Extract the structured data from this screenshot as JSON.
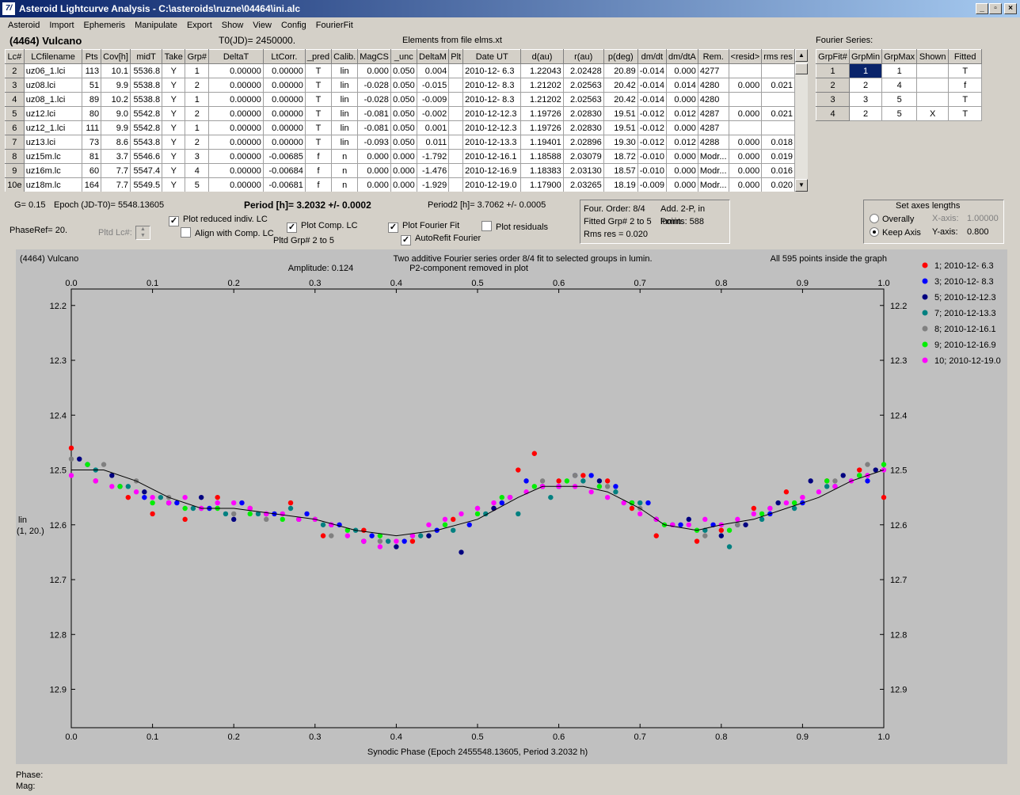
{
  "window": {
    "title": "Asteroid Lightcurve Analysis - C:\\asteroids\\ruzne\\04464\\ini.alc",
    "icon": "app-icon"
  },
  "menu": [
    "Asteroid",
    "Import",
    "Ephemeris",
    "Manipulate",
    "Export",
    "Show",
    "View",
    "Config",
    "FourierFit"
  ],
  "header": {
    "object": "(4464) Vulcano",
    "t0": "T0(JD)= 2450000.",
    "elements": "Elements from file elms.xt",
    "fourier_title": "Fourier Series:"
  },
  "lc_table": {
    "columns": [
      "Lc#",
      "LCfilename",
      "Pts",
      "Cov[h]",
      "midT",
      "Take",
      "Grp#",
      "DeltaT",
      "LtCorr.",
      "_pred",
      "Calib.",
      "MagCS",
      "_unc",
      "DeltaM",
      "Plt",
      "Date UT",
      "d(au)",
      "r(au)",
      "p(deg)",
      "dm/dt",
      "dm/dtA",
      "Rem.",
      "<resid>",
      "rms res"
    ],
    "rows": [
      [
        "2",
        "uz06_1.lci",
        "113",
        "10.1",
        "5536.8",
        "Y",
        "1",
        "0.00000",
        "0.00000",
        "T",
        "lin",
        "0.000",
        "0.050",
        "0.004",
        "",
        "2010-12- 6.3",
        "1.22043",
        "2.02428",
        "20.89",
        "-0.014",
        "0.000",
        "4277",
        "",
        ""
      ],
      [
        "3",
        "uz08.lci",
        "51",
        "9.9",
        "5538.8",
        "Y",
        "2",
        "0.00000",
        "0.00000",
        "T",
        "lin",
        "-0.028",
        "0.050",
        "-0.015",
        "",
        "2010-12- 8.3",
        "1.21202",
        "2.02563",
        "20.42",
        "-0.014",
        "0.014",
        "4280",
        "0.000",
        "0.021"
      ],
      [
        "4",
        "uz08_1.lci",
        "89",
        "10.2",
        "5538.8",
        "Y",
        "1",
        "0.00000",
        "0.00000",
        "T",
        "lin",
        "-0.028",
        "0.050",
        "-0.009",
        "",
        "2010-12- 8.3",
        "1.21202",
        "2.02563",
        "20.42",
        "-0.014",
        "0.000",
        "4280",
        "",
        ""
      ],
      [
        "5",
        "uz12.lci",
        "80",
        "9.0",
        "5542.8",
        "Y",
        "2",
        "0.00000",
        "0.00000",
        "T",
        "lin",
        "-0.081",
        "0.050",
        "-0.002",
        "",
        "2010-12-12.3",
        "1.19726",
        "2.02830",
        "19.51",
        "-0.012",
        "0.012",
        "4287",
        "0.000",
        "0.021"
      ],
      [
        "6",
        "uz12_1.lci",
        "111",
        "9.9",
        "5542.8",
        "Y",
        "1",
        "0.00000",
        "0.00000",
        "T",
        "lin",
        "-0.081",
        "0.050",
        "0.001",
        "",
        "2010-12-12.3",
        "1.19726",
        "2.02830",
        "19.51",
        "-0.012",
        "0.000",
        "4287",
        "",
        ""
      ],
      [
        "7",
        "uz13.lci",
        "73",
        "8.6",
        "5543.8",
        "Y",
        "2",
        "0.00000",
        "0.00000",
        "T",
        "lin",
        "-0.093",
        "0.050",
        "0.011",
        "",
        "2010-12-13.3",
        "1.19401",
        "2.02896",
        "19.30",
        "-0.012",
        "0.012",
        "4288",
        "0.000",
        "0.018"
      ],
      [
        "8",
        "uz15m.lc",
        "81",
        "3.7",
        "5546.6",
        "Y",
        "3",
        "0.00000",
        "-0.00685",
        "f",
        "n",
        "0.000",
        "0.000",
        "-1.792",
        "",
        "2010-12-16.1",
        "1.18588",
        "2.03079",
        "18.72",
        "-0.010",
        "0.000",
        "Modr...",
        "0.000",
        "0.019"
      ],
      [
        "9",
        "uz16m.lc",
        "60",
        "7.7",
        "5547.4",
        "Y",
        "4",
        "0.00000",
        "-0.00684",
        "f",
        "n",
        "0.000",
        "0.000",
        "-1.476",
        "",
        "2010-12-16.9",
        "1.18383",
        "2.03130",
        "18.57",
        "-0.010",
        "0.000",
        "Modr...",
        "0.000",
        "0.016"
      ],
      [
        "10e",
        "uz18m.lc",
        "164",
        "7.7",
        "5549.5",
        "Y",
        "5",
        "0.00000",
        "-0.00681",
        "f",
        "n",
        "0.000",
        "0.000",
        "-1.929",
        "",
        "2010-12-19.0",
        "1.17900",
        "2.03265",
        "18.19",
        "-0.009",
        "0.000",
        "Modr...",
        "0.000",
        "0.020"
      ]
    ]
  },
  "fourier_table": {
    "columns": [
      "GrpFit#",
      "GrpMin",
      "GrpMax",
      "Shown",
      "Fitted"
    ],
    "rows": [
      [
        "1",
        "1",
        "1",
        "",
        "T"
      ],
      [
        "2",
        "2",
        "4",
        "",
        "f"
      ],
      [
        "3",
        "3",
        "5",
        "",
        "T"
      ],
      [
        "4",
        "2",
        "5",
        "X",
        "T"
      ]
    ]
  },
  "controls": {
    "g": "G= 0.15",
    "epoch": "Epoch (JD-T0)= 5548.13605",
    "period": "Period [h]= 3.2032 +/- 0.0002",
    "period2": "Period2 [h]= 3.7062 +/- 0.0005",
    "phaseref": "PhaseRef= 20.",
    "pltd_lc": "Pltd Lc#:",
    "pltd_grp": "Pltd Grp#  2  to  5",
    "plot_reduced": "Plot reduced indiv. LC",
    "align_comp": "Align with Comp. LC",
    "plot_comp": "Plot Comp. LC",
    "plot_fourier": "Plot Fourier Fit",
    "autorefit": "AutoRefit Fourier",
    "plot_resid": "Plot residuals",
    "info1a": "Four. Order:  8/4",
    "info1b": "Add. 2-P, in lumin.",
    "info2a": "Fitted Grp# 2 to 5",
    "info2b": "Points: 588",
    "info3": "Rms res    = 0.020",
    "axes_title": "Set axes lengths",
    "overally": "Overally",
    "keep_axis": "Keep Axis",
    "xaxis_label": "X-axis:",
    "xaxis_val": "1.00000",
    "yaxis_label": "Y-axis:",
    "yaxis_val": "0.800"
  },
  "status": {
    "phase": "Phase:",
    "mag": "Mag:"
  },
  "chart_data": {
    "type": "scatter",
    "title": "Two additive Fourier series order 8/4 fit to selected groups in lumin.",
    "subtitle_left": "Amplitude: 0.124",
    "subtitle_right": "P2-component removed in plot",
    "corner_left": "(4464) Vulcano",
    "corner_right": "All 595 points inside the graph",
    "xlabel": "Synodic Phase (Epoch 2455548.13605, Period 3.2032 h)",
    "ylabel_1": "lin",
    "ylabel_2": "(1, 20.)",
    "xlim": [
      0,
      1
    ],
    "ylim": [
      12.17,
      12.97
    ],
    "y_inverted": true,
    "xticks": [
      "0.0",
      "0.1",
      "0.2",
      "0.3",
      "0.4",
      "0.5",
      "0.6",
      "0.7",
      "0.8",
      "0.9",
      "1.0"
    ],
    "yticks": [
      "12.2",
      "12.3",
      "12.4",
      "12.5",
      "12.6",
      "12.7",
      "12.8",
      "12.9"
    ],
    "ytick_values": [
      12.2,
      12.3,
      12.4,
      12.5,
      12.6,
      12.7,
      12.8,
      12.9
    ],
    "fit_curve": {
      "x": [
        0,
        0.04,
        0.08,
        0.12,
        0.16,
        0.2,
        0.25,
        0.3,
        0.35,
        0.4,
        0.45,
        0.5,
        0.55,
        0.58,
        0.6,
        0.63,
        0.66,
        0.7,
        0.73,
        0.77,
        0.8,
        0.84,
        0.88,
        0.92,
        0.96,
        1.0
      ],
      "y": [
        12.5,
        12.5,
        12.52,
        12.55,
        12.57,
        12.57,
        12.58,
        12.59,
        12.61,
        12.62,
        12.61,
        12.59,
        12.55,
        12.53,
        12.53,
        12.53,
        12.54,
        12.57,
        12.6,
        12.61,
        12.6,
        12.59,
        12.57,
        12.55,
        12.52,
        12.5
      ]
    },
    "series": [
      {
        "name": "1; 2010-12- 6.3",
        "color": "#ff0000",
        "marker": "circle",
        "x": [
          0.0,
          0.03,
          0.07,
          0.1,
          0.14,
          0.18,
          0.22,
          0.27,
          0.31,
          0.36,
          0.42,
          0.47,
          0.52,
          0.55,
          0.57,
          0.6,
          0.63,
          0.66,
          0.69,
          0.72,
          0.77,
          0.8,
          0.84,
          0.88,
          0.93,
          0.97,
          1.0
        ],
        "y": [
          12.46,
          12.52,
          12.55,
          12.58,
          12.59,
          12.55,
          12.57,
          12.56,
          12.62,
          12.61,
          12.63,
          12.59,
          12.57,
          12.5,
          12.47,
          12.52,
          12.51,
          12.52,
          12.57,
          12.62,
          12.63,
          12.61,
          12.57,
          12.54,
          12.52,
          12.5,
          12.55
        ]
      },
      {
        "name": "3; 2010-12- 8.3",
        "color": "#0000ff",
        "marker": "circle",
        "x": [
          0.02,
          0.06,
          0.09,
          0.13,
          0.17,
          0.21,
          0.25,
          0.29,
          0.33,
          0.37,
          0.41,
          0.45,
          0.49,
          0.53,
          0.56,
          0.6,
          0.64,
          0.67,
          0.71,
          0.75,
          0.79,
          0.82,
          0.86,
          0.9,
          0.94,
          0.98
        ],
        "y": [
          12.49,
          12.53,
          12.55,
          12.56,
          12.57,
          12.56,
          12.58,
          12.58,
          12.6,
          12.62,
          12.63,
          12.61,
          12.6,
          12.56,
          12.52,
          12.53,
          12.51,
          12.53,
          12.56,
          12.6,
          12.6,
          12.6,
          12.58,
          12.56,
          12.53,
          12.52
        ]
      },
      {
        "name": "5; 2010-12-12.3",
        "color": "#000080",
        "marker": "circle",
        "x": [
          0.01,
          0.05,
          0.09,
          0.12,
          0.16,
          0.2,
          0.24,
          0.28,
          0.32,
          0.36,
          0.4,
          0.44,
          0.48,
          0.52,
          0.54,
          0.58,
          0.62,
          0.65,
          0.69,
          0.72,
          0.76,
          0.8,
          0.83,
          0.87,
          0.91,
          0.95,
          0.99
        ],
        "y": [
          12.48,
          12.51,
          12.54,
          12.56,
          12.55,
          12.59,
          12.58,
          12.59,
          12.6,
          12.63,
          12.64,
          12.62,
          12.65,
          12.57,
          12.55,
          12.53,
          12.51,
          12.52,
          12.56,
          12.59,
          12.59,
          12.62,
          12.6,
          12.56,
          12.52,
          12.51,
          12.5
        ]
      },
      {
        "name": "7; 2010-12-13.3",
        "color": "#008080",
        "marker": "circle",
        "x": [
          0.03,
          0.07,
          0.11,
          0.15,
          0.19,
          0.23,
          0.27,
          0.31,
          0.35,
          0.39,
          0.43,
          0.47,
          0.51,
          0.55,
          0.59,
          0.63,
          0.67,
          0.7,
          0.74,
          0.78,
          0.81,
          0.85,
          0.89,
          0.93,
          0.97
        ],
        "y": [
          12.5,
          12.53,
          12.55,
          12.57,
          12.58,
          12.58,
          12.57,
          12.6,
          12.61,
          12.63,
          12.62,
          12.61,
          12.58,
          12.58,
          12.55,
          12.52,
          12.54,
          12.56,
          12.6,
          12.61,
          12.64,
          12.59,
          12.57,
          12.53,
          12.51
        ]
      },
      {
        "name": "8; 2010-12-16.1",
        "color": "#808080",
        "marker": "circle",
        "x": [
          0.0,
          0.04,
          0.08,
          0.12,
          0.16,
          0.2,
          0.24,
          0.28,
          0.32,
          0.38,
          0.42,
          0.46,
          0.5,
          0.54,
          0.58,
          0.62,
          0.66,
          0.7,
          0.74,
          0.78,
          0.82,
          0.86,
          0.9,
          0.94,
          0.98
        ],
        "y": [
          12.48,
          12.49,
          12.52,
          12.55,
          12.57,
          12.58,
          12.59,
          12.59,
          12.62,
          12.63,
          12.62,
          12.6,
          12.57,
          12.55,
          12.52,
          12.51,
          12.53,
          12.57,
          12.6,
          12.62,
          12.6,
          12.57,
          12.55,
          12.52,
          12.49
        ]
      },
      {
        "name": "9; 2010-12-16.9",
        "color": "#00ee00",
        "marker": "circle",
        "x": [
          0.02,
          0.06,
          0.1,
          0.14,
          0.18,
          0.22,
          0.26,
          0.3,
          0.34,
          0.38,
          0.42,
          0.46,
          0.5,
          0.53,
          0.57,
          0.61,
          0.65,
          0.69,
          0.73,
          0.77,
          0.81,
          0.85,
          0.89,
          0.93,
          0.97,
          1.0
        ],
        "y": [
          12.49,
          12.53,
          12.56,
          12.57,
          12.57,
          12.58,
          12.59,
          12.59,
          12.61,
          12.62,
          12.62,
          12.6,
          12.58,
          12.55,
          12.53,
          12.52,
          12.53,
          12.56,
          12.6,
          12.61,
          12.61,
          12.58,
          12.56,
          12.52,
          12.51,
          12.49
        ]
      },
      {
        "name": "10; 2010-12-19.0",
        "color": "#ff00ff",
        "marker": "circle",
        "x": [
          0.0,
          0.03,
          0.05,
          0.08,
          0.1,
          0.12,
          0.14,
          0.16,
          0.18,
          0.2,
          0.22,
          0.24,
          0.26,
          0.28,
          0.3,
          0.32,
          0.34,
          0.36,
          0.38,
          0.4,
          0.42,
          0.44,
          0.46,
          0.48,
          0.5,
          0.52,
          0.54,
          0.56,
          0.58,
          0.6,
          0.62,
          0.64,
          0.66,
          0.68,
          0.7,
          0.72,
          0.74,
          0.76,
          0.78,
          0.8,
          0.82,
          0.84,
          0.86,
          0.88,
          0.9,
          0.92,
          0.94,
          0.96,
          0.98,
          1.0
        ],
        "y": [
          12.51,
          12.52,
          12.53,
          12.54,
          12.55,
          12.56,
          12.55,
          12.57,
          12.56,
          12.56,
          12.57,
          12.58,
          12.58,
          12.59,
          12.59,
          12.6,
          12.62,
          12.63,
          12.64,
          12.63,
          12.62,
          12.6,
          12.59,
          12.58,
          12.57,
          12.56,
          12.55,
          12.54,
          12.53,
          12.53,
          12.53,
          12.54,
          12.55,
          12.56,
          12.58,
          12.59,
          12.6,
          12.6,
          12.59,
          12.6,
          12.59,
          12.58,
          12.57,
          12.56,
          12.55,
          12.54,
          12.53,
          12.52,
          12.51,
          12.5
        ]
      }
    ]
  }
}
